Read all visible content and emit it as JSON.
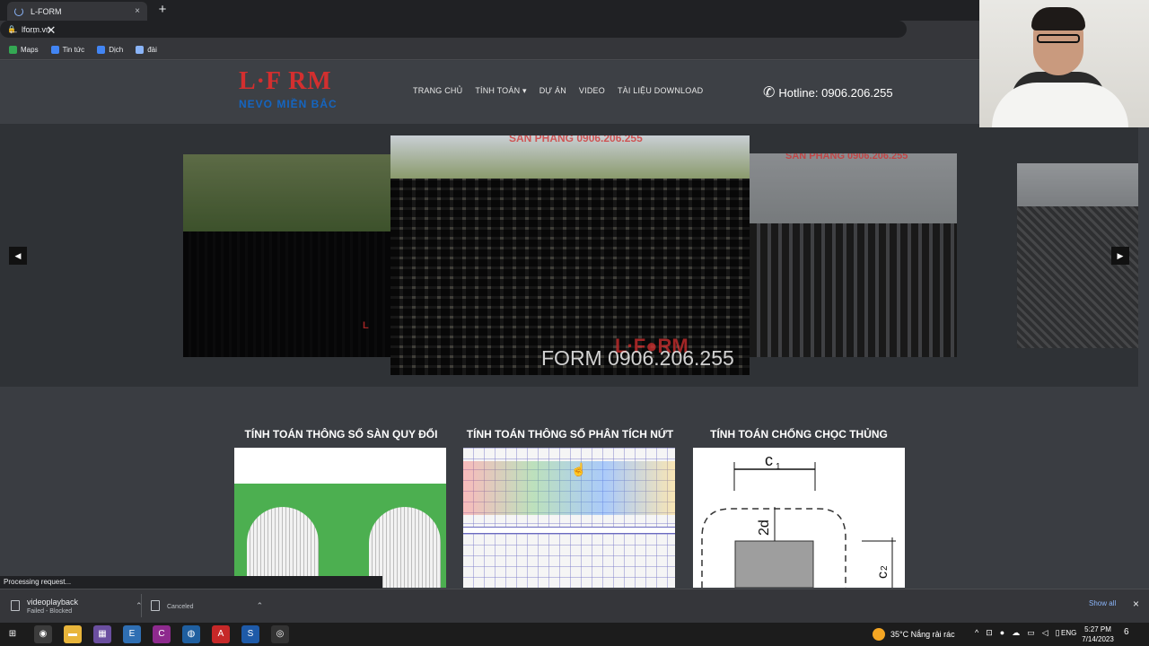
{
  "browser": {
    "tab_title": "L-FORM",
    "tab_close": "×",
    "new_tab": "+",
    "url": "lform.vn",
    "bookmarks": [
      {
        "label": "Maps",
        "color": "#34a853"
      },
      {
        "label": "Tin tức",
        "color": "#4285f4"
      },
      {
        "label": "Dịch",
        "color": "#4285f4"
      },
      {
        "label": "đài",
        "color": "#8ab4f8"
      }
    ]
  },
  "site": {
    "logo_top": "L·F  RM",
    "logo_bottom": "NEVO MIỀN BẮC",
    "nav": [
      "TRANG CHỦ",
      "TÍNH TOÁN ▾",
      "DỰ ÁN",
      "VIDEO",
      "TÀI LIỆU DOWNLOAD"
    ],
    "hotline": "Hotline: 0906.206.255",
    "carousel": {
      "prev": "◀",
      "next": "▶",
      "watermark": "FORM 0906.206.255",
      "slide_overlay": "SÀN PHẲNG 0906.206.255"
    },
    "cards": [
      {
        "title": "TÍNH TOÁN THÔNG SỐ SÀN QUY ĐỔI"
      },
      {
        "title": "TÍNH TOÁN THÔNG SỐ PHÂN TÍCH NỨT"
      },
      {
        "title": "TÍNH TOÁN CHỐNG CHỌC THỦNG",
        "labels": [
          "c",
          "1",
          "2d",
          "c",
          "2"
        ]
      }
    ]
  },
  "status_bar": "Processing request...",
  "downloads": {
    "items": [
      {
        "name": "videoplayback",
        "status": "Failed - Blocked"
      },
      {
        "name": "",
        "status": "Canceled"
      }
    ],
    "show_all": "Show all",
    "close": "×"
  },
  "taskbar": {
    "weather": "35°C  Nắng rải rác",
    "lang": "ENG",
    "time": "5:27 PM",
    "date": "7/14/2023",
    "notif_count": "6",
    "apps": [
      {
        "icon": "windows-icon",
        "color": "#1c1c1c",
        "glyph": "⊞"
      },
      {
        "icon": "chrome-icon",
        "color": "#3c3c3c",
        "glyph": "◉"
      },
      {
        "icon": "folder-icon",
        "color": "#e8b53b",
        "glyph": "▬"
      },
      {
        "icon": "app-purple-icon",
        "color": "#6b4fa0",
        "glyph": "▦"
      },
      {
        "icon": "app-blue-icon",
        "color": "#2f6fb3",
        "glyph": "E"
      },
      {
        "icon": "app-magenta-icon",
        "color": "#8e2a8e",
        "glyph": "C"
      },
      {
        "icon": "app-globe-icon",
        "color": "#1f5fa0",
        "glyph": "◍"
      },
      {
        "icon": "app-red-icon",
        "color": "#c62828",
        "glyph": "A"
      },
      {
        "icon": "app-s-icon",
        "color": "#1e5aa8",
        "glyph": "S"
      },
      {
        "icon": "app-record-icon",
        "color": "#333333",
        "glyph": "◎"
      }
    ]
  }
}
